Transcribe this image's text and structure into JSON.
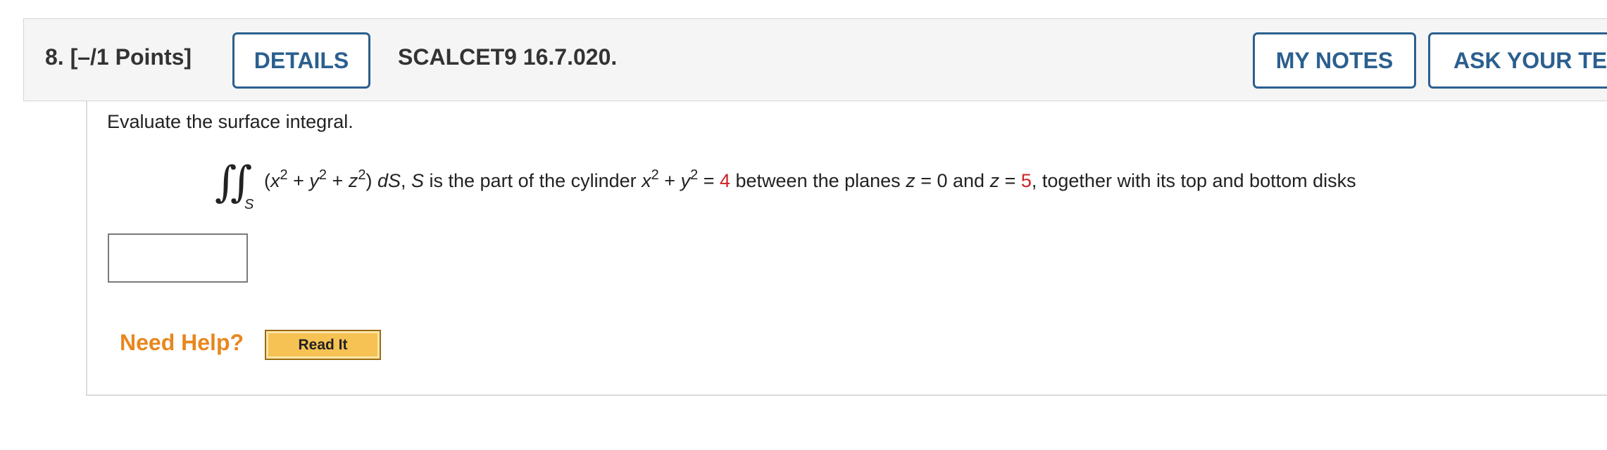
{
  "question": {
    "number": "8.",
    "points": "[–/1 Points]",
    "details_label": "DETAILS",
    "code": "SCALCET9 16.7.020.",
    "my_notes_label": "MY NOTES",
    "ask_teacher_label": "ASK YOUR TEA"
  },
  "problem": {
    "instruction": "Evaluate the surface integral.",
    "integral_subscript": "S",
    "integrand_open": "(",
    "x": "x",
    "exp2": "2",
    "plus": " + ",
    "y": "y",
    "z": "z",
    "integrand_close": ") ",
    "dS": "dS",
    "comma": ",   ",
    "S_var": "S",
    "text_cylinder": " is the part of the cylinder ",
    "equals": " = ",
    "radius_sq_value": "4",
    "text_between": " between the planes ",
    "z_lower_value": "0",
    "text_and": " and ",
    "z_upper_value": "5",
    "text_tail": ", together with its top and bottom disks"
  },
  "answer": {
    "value": ""
  },
  "help": {
    "need_help_label": "Need Help?",
    "read_it_label": "Read It"
  },
  "colors": {
    "accent_blue": "#2b5f8f",
    "highlight_red": "#cc2222",
    "help_orange": "#e8871e",
    "read_it_gold": "#f6c253"
  }
}
